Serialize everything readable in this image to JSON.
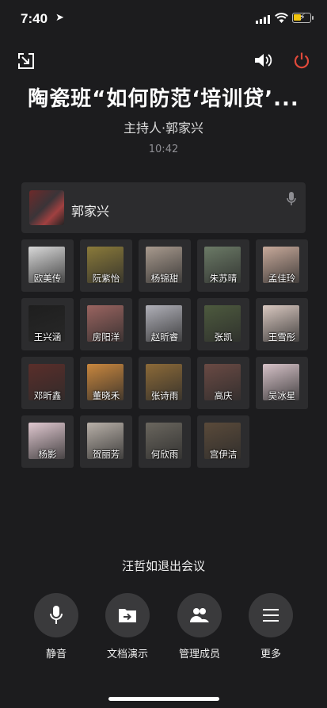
{
  "status_bar": {
    "time": "7:40"
  },
  "meeting": {
    "title": "陶瓷班“如何防范‘培训贷’...",
    "host": "主持人·郭家兴",
    "elapsed": "10:42"
  },
  "active_speaker": {
    "name": "郭家兴"
  },
  "participants": [
    {
      "name": "欧美传",
      "color": "#d8d8d8"
    },
    {
      "name": "阮紫怡",
      "color": "#8a7a3a"
    },
    {
      "name": "杨锦甜",
      "color": "#a89a8e"
    },
    {
      "name": "朱苏晴",
      "color": "#6b7a66"
    },
    {
      "name": "孟佳玲",
      "color": "#c7a99a"
    },
    {
      "name": "王兴涵",
      "color": "#1e1e1e"
    },
    {
      "name": "房阳洋",
      "color": "#9a6460"
    },
    {
      "name": "赵昕睿",
      "color": "#b0b0b8"
    },
    {
      "name": "张凯",
      "color": "#4d5a3e"
    },
    {
      "name": "王雪彤",
      "color": "#d9c8c0"
    },
    {
      "name": "邓昕鑫",
      "color": "#5a2e2a"
    },
    {
      "name": "董晓禾",
      "color": "#c9873e"
    },
    {
      "name": "张诗雨",
      "color": "#8c6a38"
    },
    {
      "name": "高庆",
      "color": "#6a4a44"
    },
    {
      "name": "吴冰星",
      "color": "#d6c2c8"
    },
    {
      "name": "杨影",
      "color": "#e0c8d0"
    },
    {
      "name": "贺丽芳",
      "color": "#b8b0a8"
    },
    {
      "name": "何欣雨",
      "color": "#6a665e"
    },
    {
      "name": "宫伊洁",
      "color": "#5a4a3a"
    }
  ],
  "notice": "汪哲如退出会议",
  "controls": {
    "mute": "静音",
    "share_doc": "文档演示",
    "manage_members": "管理成员",
    "more": "更多"
  },
  "icons": {
    "minimize": "minimize-window-icon",
    "speaker": "speaker-icon",
    "power": "power-icon",
    "accent_power": "#e0493a"
  }
}
